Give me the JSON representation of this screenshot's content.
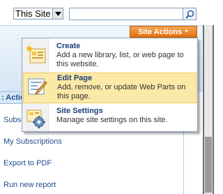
{
  "search": {
    "scope": "This Site",
    "query": ""
  },
  "site_actions": {
    "label": "Site Actions",
    "menu": [
      {
        "title": "Create",
        "description": "Add a new library, list, or web page to this website."
      },
      {
        "title": "Edit Page",
        "description": "Add, remove, or update Web Parts on this page."
      },
      {
        "title": "Site Settings",
        "description": "Manage site settings on this site."
      }
    ]
  },
  "left_nav": {
    "heading": ": Actio",
    "items": [
      "Subsc",
      "My Subscriptions",
      "Export to PDF",
      "Run new report"
    ]
  },
  "colors": {
    "site_actions_bg": "#e67e22",
    "highlight_bg": "#fbe9a8",
    "link": "#1f4e8c"
  }
}
